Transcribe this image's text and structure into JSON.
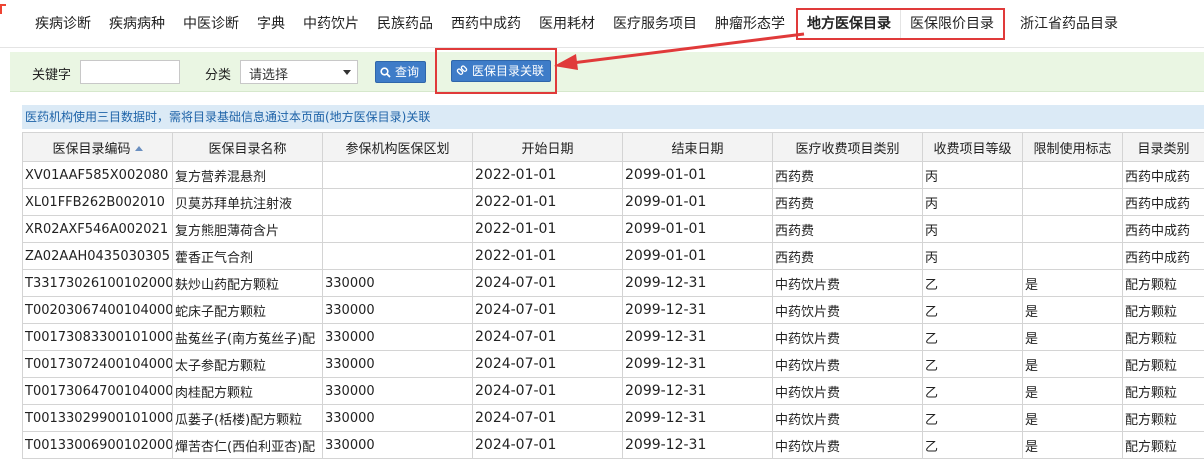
{
  "nav": {
    "tabs": [
      {
        "label": "疾病诊断"
      },
      {
        "label": "疾病病种"
      },
      {
        "label": "中医诊断"
      },
      {
        "label": "字典"
      },
      {
        "label": "中药饮片"
      },
      {
        "label": "民族药品"
      },
      {
        "label": "西药中成药"
      },
      {
        "label": "医用耗材"
      },
      {
        "label": "医疗服务项目"
      },
      {
        "label": "肿瘤形态学"
      }
    ],
    "boxed_tabs": [
      {
        "label": "地方医保目录"
      },
      {
        "label": "医保限价目录"
      }
    ],
    "last_tab": {
      "label": "浙江省药品目录"
    }
  },
  "toolbar": {
    "keyword_label": "关键字",
    "keyword_value": "",
    "category_label": "分类",
    "category_selected": "请选择",
    "search_label": "查询",
    "link_label": "医保目录关联"
  },
  "info_text": "医药机构使用三目数据时，需将目录基础信息通过本页面(地方医保目录)关联",
  "table": {
    "columns": [
      "医保目录编码",
      "医保目录名称",
      "参保机构医保区划",
      "开始日期",
      "结束日期",
      "医疗收费项目类别",
      "收费项目等级",
      "限制使用标志",
      "目录类别"
    ],
    "rows": [
      [
        "XV01AAF585X002080",
        "复方营养混悬剂",
        "",
        "2022-01-01",
        "2099-01-01",
        "西药费",
        "丙",
        "",
        "西药中成药"
      ],
      [
        "XL01FFB262B002010",
        "贝莫苏拜单抗注射液",
        "",
        "2022-01-01",
        "2099-01-01",
        "西药费",
        "丙",
        "",
        "西药中成药"
      ],
      [
        "XR02AXF546A002021",
        "复方熊胆薄荷含片",
        "",
        "2022-01-01",
        "2099-01-01",
        "西药费",
        "丙",
        "",
        "西药中成药"
      ],
      [
        "ZA02AAH0435030305",
        "藿香正气合剂",
        "",
        "2022-01-01",
        "2099-01-01",
        "西药费",
        "丙",
        "",
        "西药中成药"
      ],
      [
        "T33173026100102000",
        "麸炒山药配方颗粒",
        "330000",
        "2024-07-01",
        "2099-12-31",
        "中药饮片费",
        "乙",
        "是",
        "配方颗粒"
      ],
      [
        "T00203067400104000",
        "蛇床子配方颗粒",
        "330000",
        "2024-07-01",
        "2099-12-31",
        "中药饮片费",
        "乙",
        "是",
        "配方颗粒"
      ],
      [
        "T00173083300101000",
        "盐菟丝子(南方菟丝子)配",
        "330000",
        "2024-07-01",
        "2099-12-31",
        "中药饮片费",
        "乙",
        "是",
        "配方颗粒"
      ],
      [
        "T00173072400104000",
        "太子参配方颗粒",
        "330000",
        "2024-07-01",
        "2099-12-31",
        "中药饮片费",
        "乙",
        "是",
        "配方颗粒"
      ],
      [
        "T00173064700104000",
        "肉桂配方颗粒",
        "330000",
        "2024-07-01",
        "2099-12-31",
        "中药饮片费",
        "乙",
        "是",
        "配方颗粒"
      ],
      [
        "T00133029900101000",
        "瓜蒌子(栝楼)配方颗粒",
        "330000",
        "2024-07-01",
        "2099-12-31",
        "中药饮片费",
        "乙",
        "是",
        "配方颗粒"
      ],
      [
        "T00133006900102000",
        "燀苦杏仁(西伯利亚杏)配",
        "330000",
        "2024-07-01",
        "2099-12-31",
        "中药饮片费",
        "乙",
        "是",
        "配方颗粒"
      ]
    ]
  },
  "colors": {
    "highlight": "#e03a3a",
    "button": "#3e7cc8",
    "toolbar_bg": "#eaf6e3",
    "info_text": "#1e63a8"
  }
}
